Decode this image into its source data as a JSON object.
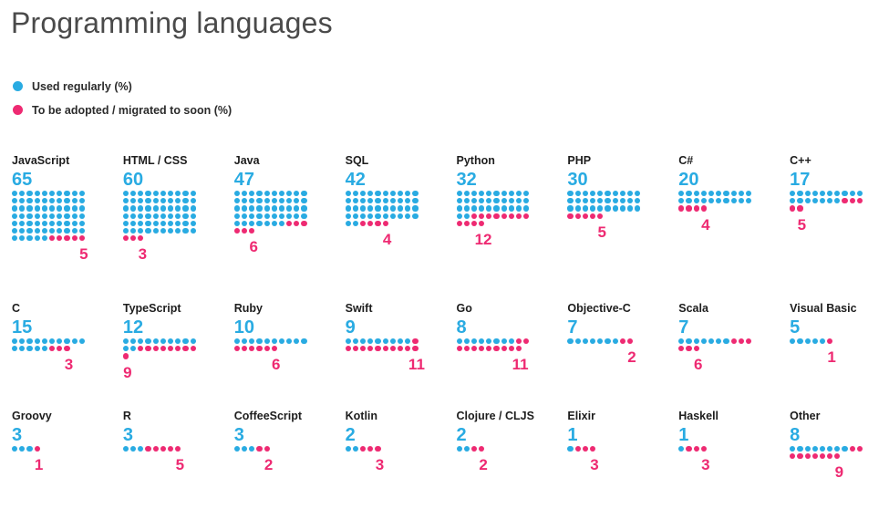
{
  "title": "Programming languages",
  "colors": {
    "used": "#29ABE2",
    "adopt": "#EE2A72",
    "title": "#4a4a4a",
    "label": "#1d1d1d",
    "background": "#ffffff"
  },
  "legend": [
    {
      "marker": "used-dot",
      "label": "Used regularly (%)",
      "color": "#29ABE2"
    },
    {
      "marker": "adopt-dot",
      "label": "To be adopted / migrated to soon (%)",
      "color": "#EE2A72"
    }
  ],
  "chart_data": {
    "type": "bar",
    "title": "Programming languages",
    "xlabel": "",
    "ylabel": "",
    "unit": "%",
    "dots_per_row": 10,
    "legend_position": "top-left",
    "grid": false,
    "categories": [
      "JavaScript",
      "HTML / CSS",
      "Java",
      "SQL",
      "Python",
      "PHP",
      "C#",
      "C++",
      "C",
      "TypeScript",
      "Ruby",
      "Swift",
      "Go",
      "Objective-C",
      "Scala",
      "Visual Basic",
      "Groovy",
      "R",
      "CoffeeScript",
      "Kotlin",
      "Clojure / CLJS",
      "Elixir",
      "Haskell",
      "Other"
    ],
    "series": [
      {
        "name": "Used regularly (%)",
        "color": "#29ABE2",
        "values": [
          65,
          60,
          47,
          42,
          32,
          30,
          20,
          17,
          15,
          12,
          10,
          9,
          8,
          7,
          7,
          5,
          3,
          3,
          3,
          2,
          2,
          1,
          1,
          8
        ]
      },
      {
        "name": "To be adopted / migrated to soon (%)",
        "color": "#EE2A72",
        "values": [
          5,
          3,
          6,
          4,
          12,
          5,
          4,
          5,
          3,
          9,
          6,
          11,
          11,
          2,
          6,
          1,
          1,
          5,
          2,
          3,
          2,
          3,
          3,
          9
        ]
      }
    ]
  },
  "rows": [
    [
      {
        "name": "JavaScript",
        "used": 65,
        "adopt": 5
      },
      {
        "name": "HTML / CSS",
        "used": 60,
        "adopt": 3
      },
      {
        "name": "Java",
        "used": 47,
        "adopt": 6
      },
      {
        "name": "SQL",
        "used": 42,
        "adopt": 4
      },
      {
        "name": "Python",
        "used": 32,
        "adopt": 12
      },
      {
        "name": "PHP",
        "used": 30,
        "adopt": 5
      },
      {
        "name": "C#",
        "used": 20,
        "adopt": 4
      },
      {
        "name": "C++",
        "used": 17,
        "adopt": 5
      }
    ],
    [
      {
        "name": "C",
        "used": 15,
        "adopt": 3
      },
      {
        "name": "TypeScript",
        "used": 12,
        "adopt": 9
      },
      {
        "name": "Ruby",
        "used": 10,
        "adopt": 6
      },
      {
        "name": "Swift",
        "used": 9,
        "adopt": 11
      },
      {
        "name": "Go",
        "used": 8,
        "adopt": 11
      },
      {
        "name": "Objective-C",
        "used": 7,
        "adopt": 2
      },
      {
        "name": "Scala",
        "used": 7,
        "adopt": 6
      },
      {
        "name": "Visual Basic",
        "used": 5,
        "adopt": 1
      }
    ],
    [
      {
        "name": "Groovy",
        "used": 3,
        "adopt": 1
      },
      {
        "name": "R",
        "used": 3,
        "adopt": 5
      },
      {
        "name": "CoffeeScript",
        "used": 3,
        "adopt": 2
      },
      {
        "name": "Kotlin",
        "used": 2,
        "adopt": 3
      },
      {
        "name": "Clojure / CLJS",
        "used": 2,
        "adopt": 2
      },
      {
        "name": "Elixir",
        "used": 1,
        "adopt": 3
      },
      {
        "name": "Haskell",
        "used": 1,
        "adopt": 3
      },
      {
        "name": "Other",
        "used": 8,
        "adopt": 9
      }
    ]
  ]
}
